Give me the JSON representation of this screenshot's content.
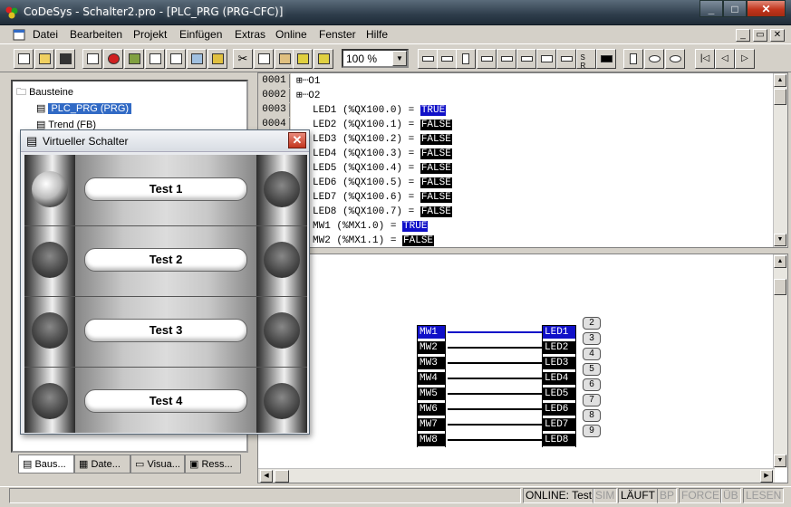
{
  "window": {
    "title": "CoDeSys - Schalter2.pro - [PLC_PRG (PRG-CFC)]"
  },
  "menu": [
    "Datei",
    "Bearbeiten",
    "Projekt",
    "Einfügen",
    "Extras",
    "Online",
    "Fenster",
    "Hilfe"
  ],
  "toolbar": {
    "zoom": "100 %"
  },
  "tree": {
    "root": "Bausteine",
    "items": [
      "PLC_PRG (PRG)",
      "Trend (FB)"
    ]
  },
  "tabs": [
    "Baus...",
    "Date...",
    "Visua...",
    "Ress..."
  ],
  "declarations": {
    "line_numbers": [
      "0001",
      "0002",
      "0003",
      "0004"
    ],
    "groups": [
      "O1",
      "O2"
    ],
    "rows": [
      {
        "name": "LED1 (%QX100.0) =",
        "value": "TRUE"
      },
      {
        "name": "LED2 (%QX100.1) =",
        "value": "FALSE"
      },
      {
        "name": "LED3 (%QX100.2) =",
        "value": "FALSE"
      },
      {
        "name": "LED4 (%QX100.3) =",
        "value": "FALSE"
      },
      {
        "name": "LED5 (%QX100.4) =",
        "value": "FALSE"
      },
      {
        "name": "LED6 (%QX100.5) =",
        "value": "FALSE"
      },
      {
        "name": "LED7 (%QX100.6) =",
        "value": "FALSE"
      },
      {
        "name": "LED8 (%QX100.7) =",
        "value": "FALSE"
      },
      {
        "name": "MW1 (%MX1.0) =",
        "value": "TRUE"
      },
      {
        "name": "MW2 (%MX1.1) =",
        "value": "FALSE"
      }
    ]
  },
  "cfc": {
    "inputs": [
      "MW1",
      "MW2",
      "MW3",
      "MW4",
      "MW5",
      "MW6",
      "MW7",
      "MW8"
    ],
    "outputs": [
      "LED1",
      "LED2",
      "LED3",
      "LED4",
      "LED5",
      "LED6",
      "LED7",
      "LED8"
    ],
    "order": [
      "2",
      "3",
      "4",
      "5",
      "6",
      "7",
      "8",
      "9"
    ],
    "active_index": 0
  },
  "dialog": {
    "title": "Virtueller Schalter",
    "buttons": [
      "Test 1",
      "Test 2",
      "Test 3",
      "Test 4"
    ]
  },
  "status": {
    "online": "ONLINE: Test",
    "sim": "SIM",
    "run": "LÄUFT",
    "bp": "BP",
    "force": "FORCE",
    "ub": "ÜB",
    "lesen": "LESEN"
  }
}
